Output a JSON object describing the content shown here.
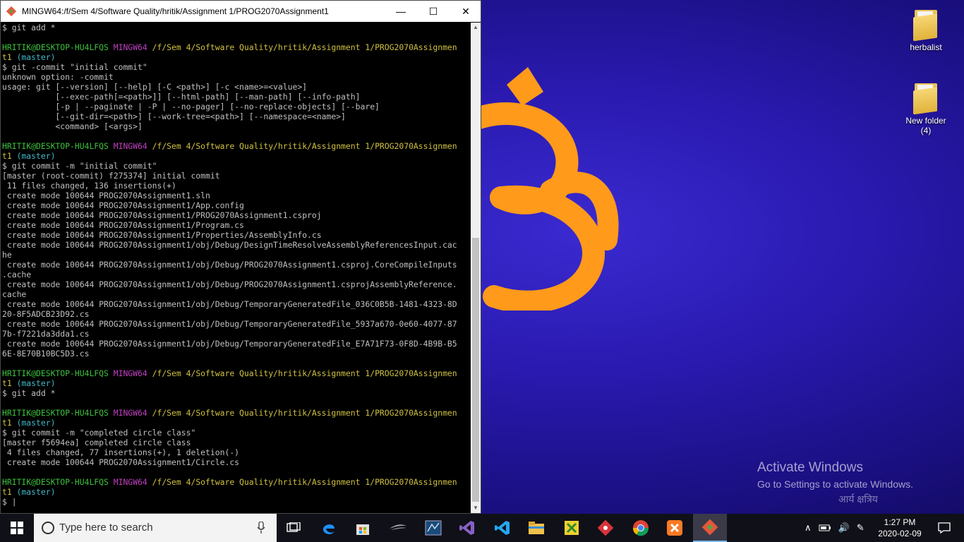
{
  "terminal": {
    "title": "MINGW64:/f/Sem 4/Software Quality/hritik/Assignment 1/PROG2070Assignment1",
    "lines": [
      [
        {
          "t": "$ git add *",
          "c": ""
        }
      ],
      [
        {
          "t": "",
          "c": ""
        }
      ],
      [
        {
          "t": "HRITIK@DESKTOP-HU4LFQS ",
          "c": "g"
        },
        {
          "t": "MINGW64 ",
          "c": "m"
        },
        {
          "t": "/f/Sem 4/Software Quality/hritik/Assignment 1/PROG2070Assignmen",
          "c": "y"
        }
      ],
      [
        {
          "t": "t1",
          "c": "y"
        },
        {
          "t": " (master)",
          "c": "c"
        }
      ],
      [
        {
          "t": "$ git -commit \"initial commit\"",
          "c": ""
        }
      ],
      [
        {
          "t": "unknown option: -commit",
          "c": ""
        }
      ],
      [
        {
          "t": "usage: git [--version] [--help] [-C <path>] [-c <name>=<value>]",
          "c": ""
        }
      ],
      [
        {
          "t": "           [--exec-path[=<path>]] [--html-path] [--man-path] [--info-path]",
          "c": ""
        }
      ],
      [
        {
          "t": "           [-p | --paginate | -P | --no-pager] [--no-replace-objects] [--bare]",
          "c": ""
        }
      ],
      [
        {
          "t": "           [--git-dir=<path>] [--work-tree=<path>] [--namespace=<name>]",
          "c": ""
        }
      ],
      [
        {
          "t": "           <command> [<args>]",
          "c": ""
        }
      ],
      [
        {
          "t": "",
          "c": ""
        }
      ],
      [
        {
          "t": "HRITIK@DESKTOP-HU4LFQS ",
          "c": "g"
        },
        {
          "t": "MINGW64 ",
          "c": "m"
        },
        {
          "t": "/f/Sem 4/Software Quality/hritik/Assignment 1/PROG2070Assignmen",
          "c": "y"
        }
      ],
      [
        {
          "t": "t1",
          "c": "y"
        },
        {
          "t": " (master)",
          "c": "c"
        }
      ],
      [
        {
          "t": "$ git commit -m \"initial commit\"",
          "c": ""
        }
      ],
      [
        {
          "t": "[master (root-commit) f275374] initial commit",
          "c": ""
        }
      ],
      [
        {
          "t": " 11 files changed, 136 insertions(+)",
          "c": ""
        }
      ],
      [
        {
          "t": " create mode 100644 PROG2070Assignment1.sln",
          "c": ""
        }
      ],
      [
        {
          "t": " create mode 100644 PROG2070Assignment1/App.config",
          "c": ""
        }
      ],
      [
        {
          "t": " create mode 100644 PROG2070Assignment1/PROG2070Assignment1.csproj",
          "c": ""
        }
      ],
      [
        {
          "t": " create mode 100644 PROG2070Assignment1/Program.cs",
          "c": ""
        }
      ],
      [
        {
          "t": " create mode 100644 PROG2070Assignment1/Properties/AssemblyInfo.cs",
          "c": ""
        }
      ],
      [
        {
          "t": " create mode 100644 PROG2070Assignment1/obj/Debug/DesignTimeResolveAssemblyReferencesInput.cac",
          "c": ""
        }
      ],
      [
        {
          "t": "he",
          "c": ""
        }
      ],
      [
        {
          "t": " create mode 100644 PROG2070Assignment1/obj/Debug/PROG2070Assignment1.csproj.CoreCompileInputs",
          "c": ""
        }
      ],
      [
        {
          "t": ".cache",
          "c": ""
        }
      ],
      [
        {
          "t": " create mode 100644 PROG2070Assignment1/obj/Debug/PROG2070Assignment1.csprojAssemblyReference.",
          "c": ""
        }
      ],
      [
        {
          "t": "cache",
          "c": ""
        }
      ],
      [
        {
          "t": " create mode 100644 PROG2070Assignment1/obj/Debug/TemporaryGeneratedFile_036C0B5B-1481-4323-8D",
          "c": ""
        }
      ],
      [
        {
          "t": "20-8F5ADCB23D92.cs",
          "c": ""
        }
      ],
      [
        {
          "t": " create mode 100644 PROG2070Assignment1/obj/Debug/TemporaryGeneratedFile_5937a670-0e60-4077-87",
          "c": ""
        }
      ],
      [
        {
          "t": "7b-f7221da3dda1.cs",
          "c": ""
        }
      ],
      [
        {
          "t": " create mode 100644 PROG2070Assignment1/obj/Debug/TemporaryGeneratedFile_E7A71F73-0F8D-4B9B-B5",
          "c": ""
        }
      ],
      [
        {
          "t": "6E-8E70B10BC5D3.cs",
          "c": ""
        }
      ],
      [
        {
          "t": "",
          "c": ""
        }
      ],
      [
        {
          "t": "HRITIK@DESKTOP-HU4LFQS ",
          "c": "g"
        },
        {
          "t": "MINGW64 ",
          "c": "m"
        },
        {
          "t": "/f/Sem 4/Software Quality/hritik/Assignment 1/PROG2070Assignmen",
          "c": "y"
        }
      ],
      [
        {
          "t": "t1",
          "c": "y"
        },
        {
          "t": " (master)",
          "c": "c"
        }
      ],
      [
        {
          "t": "$ git add *",
          "c": ""
        }
      ],
      [
        {
          "t": "",
          "c": ""
        }
      ],
      [
        {
          "t": "HRITIK@DESKTOP-HU4LFQS ",
          "c": "g"
        },
        {
          "t": "MINGW64 ",
          "c": "m"
        },
        {
          "t": "/f/Sem 4/Software Quality/hritik/Assignment 1/PROG2070Assignmen",
          "c": "y"
        }
      ],
      [
        {
          "t": "t1",
          "c": "y"
        },
        {
          "t": " (master)",
          "c": "c"
        }
      ],
      [
        {
          "t": "$ git commit -m \"completed circle class\"",
          "c": ""
        }
      ],
      [
        {
          "t": "[master f5694ea] completed circle class",
          "c": ""
        }
      ],
      [
        {
          "t": " 4 files changed, 77 insertions(+), 1 deletion(-)",
          "c": ""
        }
      ],
      [
        {
          "t": " create mode 100644 PROG2070Assignment1/Circle.cs",
          "c": ""
        }
      ],
      [
        {
          "t": "",
          "c": ""
        }
      ],
      [
        {
          "t": "HRITIK@DESKTOP-HU4LFQS ",
          "c": "g"
        },
        {
          "t": "MINGW64 ",
          "c": "m"
        },
        {
          "t": "/f/Sem 4/Software Quality/hritik/Assignment 1/PROG2070Assignmen",
          "c": "y"
        }
      ],
      [
        {
          "t": "t1",
          "c": "y"
        },
        {
          "t": " (master)",
          "c": "c"
        }
      ],
      [
        {
          "t": "$ |",
          "c": ""
        }
      ]
    ]
  },
  "desktop": {
    "icons": [
      {
        "label": "herbalist"
      },
      {
        "label": "New folder\n(4)"
      }
    ],
    "activate": {
      "title": "Activate Windows",
      "subtitle": "Go to Settings to activate Windows."
    },
    "watermark": "आर्य क्षत्रिय"
  },
  "taskbar": {
    "search_placeholder": "Type here to search",
    "apps": [
      "task-view",
      "edge",
      "store",
      "eclipse",
      "sql-server",
      "visual-studio",
      "vscode",
      "file-explorer",
      "app-manager",
      "git-extensions",
      "chrome",
      "xampp",
      "git-bash"
    ],
    "clock": {
      "time": "1:27 PM",
      "date": "2020-02-09"
    }
  },
  "colors": {
    "accent": "#76b9ed",
    "prompt_user": "#3cc23c",
    "prompt_host": "#c040c0",
    "prompt_path": "#d0c040",
    "prompt_branch": "#40b8c8"
  }
}
